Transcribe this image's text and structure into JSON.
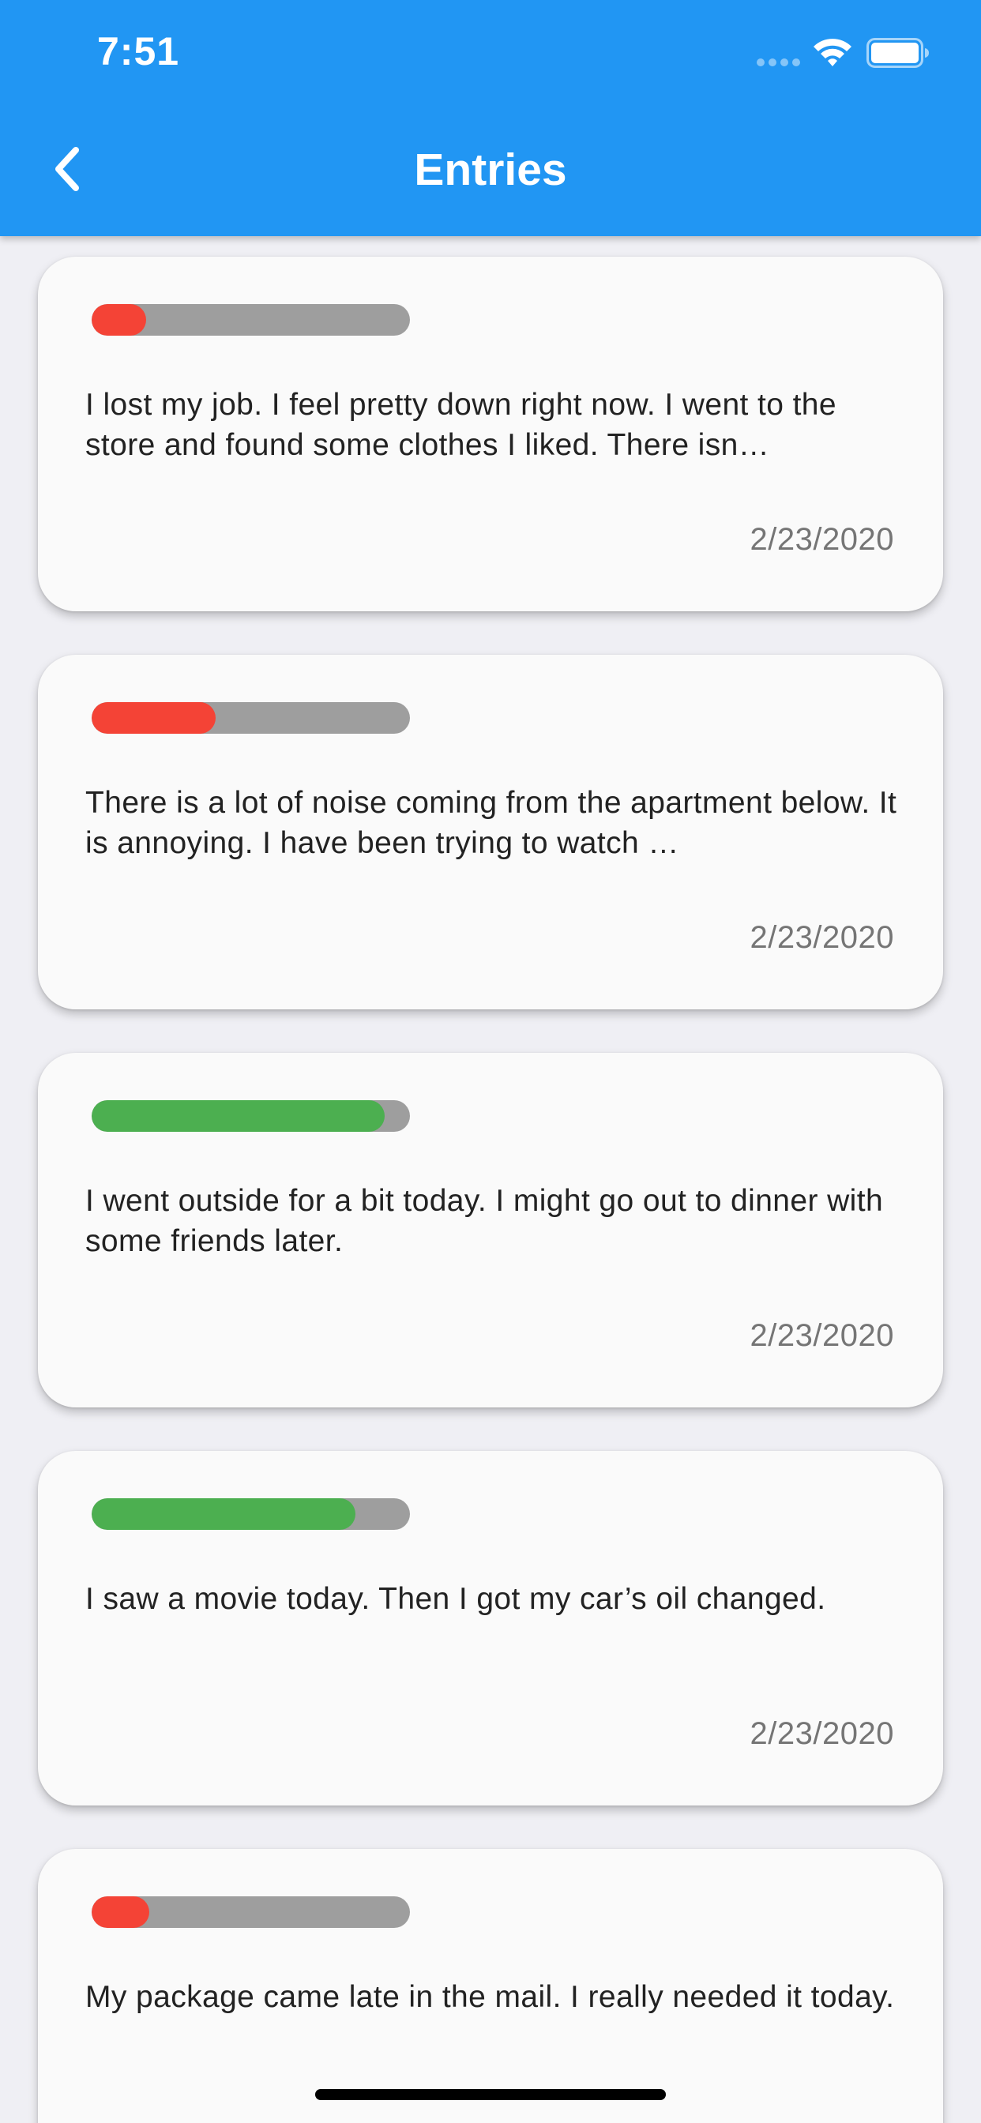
{
  "status_bar": {
    "time": "7:51"
  },
  "app_bar": {
    "title": "Entries",
    "back_icon": "chevron-left-icon"
  },
  "colors": {
    "app_bar": "#2196f3",
    "mood_negative": "#f44336",
    "mood_positive": "#4caf50",
    "track": "#9e9e9e"
  },
  "entries": [
    {
      "text": "I lost my job.  I feel pretty down right now.  I went to the store and found some clothes I liked.  There isn…",
      "date": "2/23/2020",
      "mood_level": 0.17,
      "mood_color": "#f44336"
    },
    {
      "text": "There is a lot of noise coming from the apartment below.  It is annoying.  I have been trying to watch …",
      "date": "2/23/2020",
      "mood_level": 0.39,
      "mood_color": "#f44336"
    },
    {
      "text": "I went outside for a bit today.  I might go out to dinner with some friends later.",
      "date": "2/23/2020",
      "mood_level": 0.92,
      "mood_color": "#4caf50"
    },
    {
      "text": "I saw a movie today.  Then I got my car’s oil changed.",
      "date": "2/23/2020",
      "mood_level": 0.83,
      "mood_color": "#4caf50"
    },
    {
      "text": "My package came late in the mail.  I really needed it today.",
      "date": "",
      "mood_level": 0.18,
      "mood_color": "#f44336"
    }
  ]
}
